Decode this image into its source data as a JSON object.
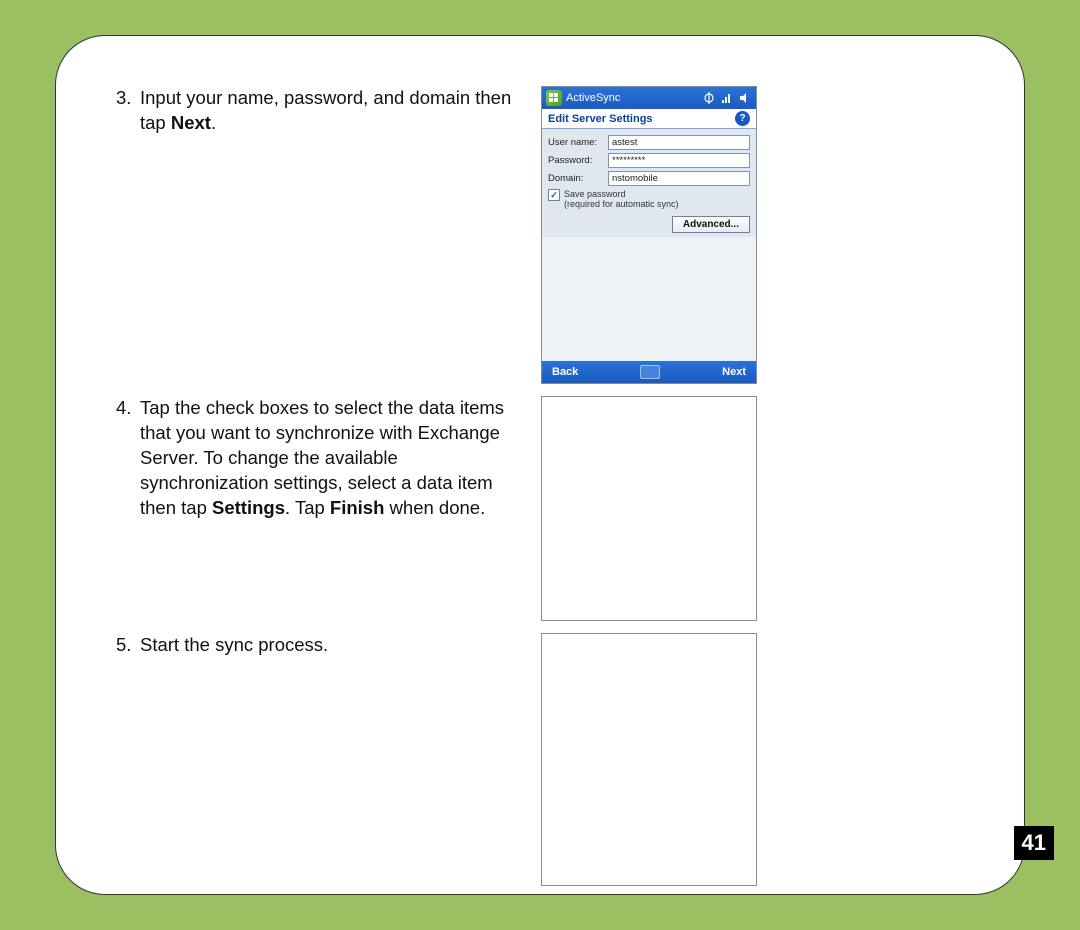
{
  "page_number": "41",
  "steps": [
    {
      "num": "3.",
      "text_before_bold": "Input your name, password, and domain then tap ",
      "bold1": "Next",
      "text_after": "."
    },
    {
      "num": "4.",
      "text_before_bold": "Tap the check boxes to select the data items that you want to synchronize with Exchange Server. To change the available synchronization settings, select a data item then tap ",
      "bold1": "Settings",
      "mid_text": ". Tap ",
      "bold2": "Finish",
      "text_after": " when done."
    },
    {
      "num": "5.",
      "text_before_bold": "Start the sync process.",
      "bold1": "",
      "text_after": ""
    }
  ],
  "device": {
    "titlebar_app": "ActiveSync",
    "subheader": "Edit Server Settings",
    "help_symbol": "?",
    "labels": {
      "username": "User name:",
      "password": "Password:",
      "domain": "Domain:"
    },
    "values": {
      "username": "astest",
      "password": "*********",
      "domain": "nstomobile"
    },
    "save_password_line1": "Save password",
    "save_password_line2": "(required for automatic sync)",
    "advanced_btn": "Advanced...",
    "back": "Back",
    "next": "Next"
  }
}
